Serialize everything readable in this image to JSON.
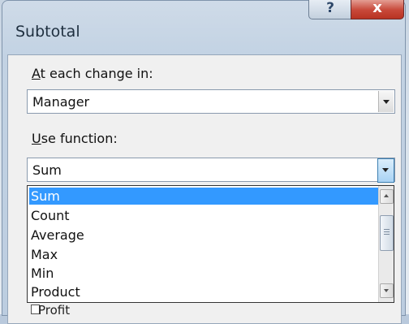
{
  "dialog": {
    "title": "Subtotal",
    "help_label": "?",
    "close_label": "x"
  },
  "change_field": {
    "label_accel": "A",
    "label_rest": "t each change in:",
    "value": "Manager"
  },
  "function_field": {
    "label_accel": "U",
    "label_rest": "se function:",
    "value": "Sum"
  },
  "function_options": [
    "Sum",
    "Count",
    "Average",
    "Max",
    "Min",
    "Product"
  ],
  "selected_option": "Sum",
  "partial_next": "Profit"
}
